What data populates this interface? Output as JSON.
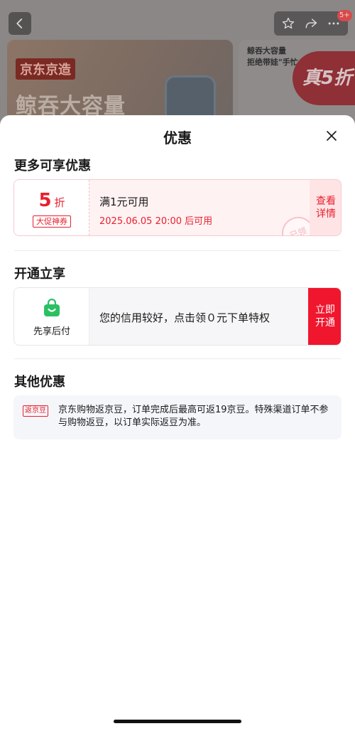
{
  "background": {
    "badge": "5+",
    "brand": "京东京造",
    "headline": "鲸吞大容量",
    "side_text_1": "鲸吞大容量",
    "side_text_2": "拒绝带娃\"手忙",
    "side_badge": "真5折"
  },
  "sheet": {
    "title": "优惠",
    "more_discounts": {
      "title": "更多可享优惠",
      "coupon": {
        "discount_number": "5",
        "discount_unit": "折",
        "tag": "大促神券",
        "condition": "满1元可用",
        "valid_time": "2025.06.05 20:00 后可用",
        "stamp": "已领",
        "action_line1": "查看",
        "action_line2": "详情"
      }
    },
    "open_enjoy": {
      "title": "开通立享",
      "label": "先享后付",
      "description": "您的信用较好，点击领０元下单特权",
      "button_line1": "立即",
      "button_line2": "开通"
    },
    "other": {
      "title": "其他优惠",
      "tag": "返京豆",
      "text": "京东购物返京豆，订单完成后最高可返19京豆。特殊渠道订单不参与购物返豆，以订单实际返豆为准。"
    }
  },
  "colors": {
    "accent_red": "#e8202e",
    "button_red": "#f0162e",
    "pay_green": "#2bc063"
  }
}
